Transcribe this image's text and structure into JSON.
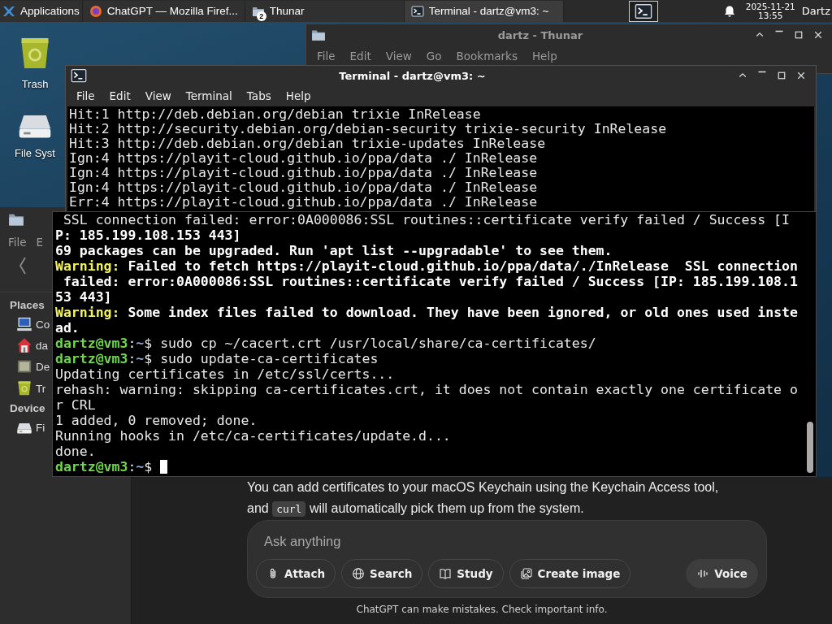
{
  "taskbar": {
    "apps_label": "Applications",
    "tasks": [
      {
        "label": "ChatGPT — Mozilla Firef...",
        "kind": "browser",
        "selected": false
      },
      {
        "label": "Thunar",
        "kind": "folder",
        "badge": "2",
        "selected": false
      },
      {
        "label": "Terminal - dartz@vm3: ~",
        "kind": "terminal",
        "selected": true
      }
    ],
    "date": "2025-11-21",
    "time": "13:55",
    "user": "Dartz"
  },
  "desktop_icons": [
    {
      "label": "Trash",
      "kind": "trash"
    },
    {
      "label": "File Syst",
      "kind": "drive"
    }
  ],
  "thunar_back": {
    "title": "dartz - Thunar",
    "menu": [
      "File",
      "Edit",
      "View",
      "Go",
      "Bookmarks",
      "Help"
    ]
  },
  "thunar_left": {
    "menu": [
      "File",
      "E"
    ],
    "sections": [
      {
        "heading": "Places",
        "items": [
          {
            "label": "Co",
            "kind": "computer"
          },
          {
            "label": "da",
            "kind": "home"
          },
          {
            "label": "De",
            "kind": "desktop"
          },
          {
            "label": "Tr",
            "kind": "trash"
          }
        ]
      },
      {
        "heading": "Device",
        "items": [
          {
            "label": "Fi",
            "kind": "drive"
          }
        ]
      }
    ]
  },
  "terminal": {
    "title": "Terminal - dartz@vm3: ~",
    "menu": [
      "File",
      "Edit",
      "View",
      "Terminal",
      "Tabs",
      "Help"
    ],
    "lines": [
      [
        {
          "kind": "plain",
          "text": "Hit:1 http://deb.debian.org/debian trixie InRelease"
        }
      ],
      [
        {
          "kind": "plain",
          "text": "Hit:2 http://security.debian.org/debian-security trixie-security InRelease"
        }
      ],
      [
        {
          "kind": "plain",
          "text": "Hit:3 http://deb.debian.org/debian trixie-updates InRelease"
        }
      ],
      [
        {
          "kind": "plain",
          "text": "Ign:4 https://playit-cloud.github.io/ppa/data ./ InRelease"
        }
      ],
      [
        {
          "kind": "plain",
          "text": "Ign:4 https://playit-cloud.github.io/ppa/data ./ InRelease"
        }
      ],
      [
        {
          "kind": "plain",
          "text": "Ign:4 https://playit-cloud.github.io/ppa/data ./ InRelease"
        }
      ],
      [
        {
          "kind": "plain",
          "text": "Err:4 https://playit-cloud.github.io/ppa/data ./ InRelease"
        }
      ]
    ],
    "lower_lines": [
      [
        {
          "kind": "plain",
          "text": " SSL connection failed: error:0A000086:SSL routines::certificate verify failed / Success [I"
        }
      ],
      [
        {
          "kind": "bold",
          "text": "P: 185.199.108.153 443]"
        }
      ],
      [
        {
          "kind": "bold",
          "text": "69 packages can be upgraded. Run 'apt list --upgradable' to see them."
        }
      ],
      [
        {
          "kind": "warning",
          "text": "Warning:"
        },
        {
          "kind": "bold",
          "text": " Failed to fetch https://playit-cloud.github.io/ppa/data/./InRelease  SSL connection"
        }
      ],
      [
        {
          "kind": "bold",
          "text": " failed: error:0A000086:SSL routines::certificate verify failed / Success [IP: 185.199.108.1"
        }
      ],
      [
        {
          "kind": "bold",
          "text": "53 443]"
        }
      ],
      [
        {
          "kind": "warning",
          "text": "Warning:"
        },
        {
          "kind": "bold",
          "text": " Some index files failed to download. They have been ignored, or old ones used inste"
        }
      ],
      [
        {
          "kind": "bold",
          "text": "ad."
        }
      ],
      [
        {
          "kind": "prompt",
          "text": "dartz@vm3"
        },
        {
          "kind": "plain",
          "text": ":"
        },
        {
          "kind": "path",
          "text": "~"
        },
        {
          "kind": "plain",
          "text": "$ sudo cp ~/cacert.crt /usr/local/share/ca-certificates/"
        }
      ],
      [
        {
          "kind": "prompt",
          "text": "dartz@vm3"
        },
        {
          "kind": "plain",
          "text": ":"
        },
        {
          "kind": "path",
          "text": "~"
        },
        {
          "kind": "plain",
          "text": "$ sudo update-ca-certificates"
        }
      ],
      [
        {
          "kind": "plain",
          "text": "Updating certificates in /etc/ssl/certs..."
        }
      ],
      [
        {
          "kind": "plain",
          "text": "rehash: warning: skipping ca-certificates.crt, it does not contain exactly one certificate o"
        }
      ],
      [
        {
          "kind": "plain",
          "text": "r CRL"
        }
      ],
      [
        {
          "kind": "plain",
          "text": "1 added, 0 removed; done."
        }
      ],
      [
        {
          "kind": "plain",
          "text": "Running hooks in /etc/ca-certificates/update.d..."
        }
      ],
      [
        {
          "kind": "plain",
          "text": "done."
        }
      ],
      [
        {
          "kind": "prompt",
          "text": "dartz@vm3"
        },
        {
          "kind": "plain",
          "text": ":"
        },
        {
          "kind": "path",
          "text": "~"
        },
        {
          "kind": "plain",
          "text": "$ "
        }
      ]
    ],
    "cursor": true
  },
  "chat": {
    "paragraph": [
      {
        "kind": "text",
        "text": "You can add certificates to your macOS Keychain using the Keychain Access tool, and "
      },
      {
        "kind": "code",
        "text": "curl"
      },
      {
        "kind": "text",
        "text": " will automatically pick them up from the system."
      }
    ],
    "composer": {
      "placeholder": "Ask anything",
      "tools": [
        {
          "label": "Attach",
          "kind": "attach"
        },
        {
          "label": "Search",
          "kind": "globe"
        },
        {
          "label": "Study",
          "kind": "book"
        },
        {
          "label": "Create image",
          "kind": "image"
        }
      ],
      "voice": "Voice"
    },
    "disclaimer": "ChatGPT can make mistakes. Check important info."
  }
}
